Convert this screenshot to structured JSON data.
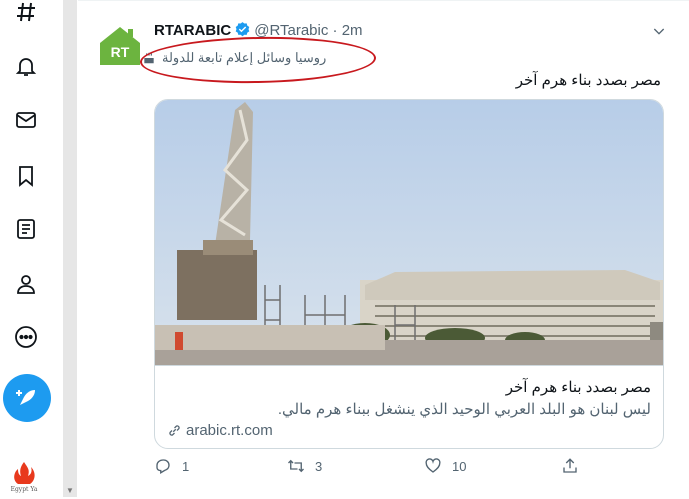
{
  "nav": {
    "items": [
      "explore-icon",
      "notifications-icon",
      "messages-icon",
      "bookmarks-icon",
      "lists-icon",
      "profile-icon",
      "more-icon"
    ],
    "compose_icon": "compose-icon",
    "badge_text": "Egypt Ya"
  },
  "tweet": {
    "author_name": "RTARABIC",
    "handle": "@RTarabic",
    "time": "· 2m",
    "label": "روسيا وسائل إعلام تابعة للدولة",
    "text": "مصر بصدد بناء هرم آخر",
    "card": {
      "title": "مصر بصدد بناء هرم آخر",
      "description": "ليس لبنان هو البلد العربي الوحيد الذي ينشغل ببناء هرم مالي.",
      "domain": "arabic.rt.com"
    },
    "actions": {
      "replies": "1",
      "retweets": "3",
      "likes": "10"
    }
  },
  "colors": {
    "accent": "#1d9bf0",
    "annotation": "#c8191e",
    "rt_green": "#6cb43f"
  }
}
